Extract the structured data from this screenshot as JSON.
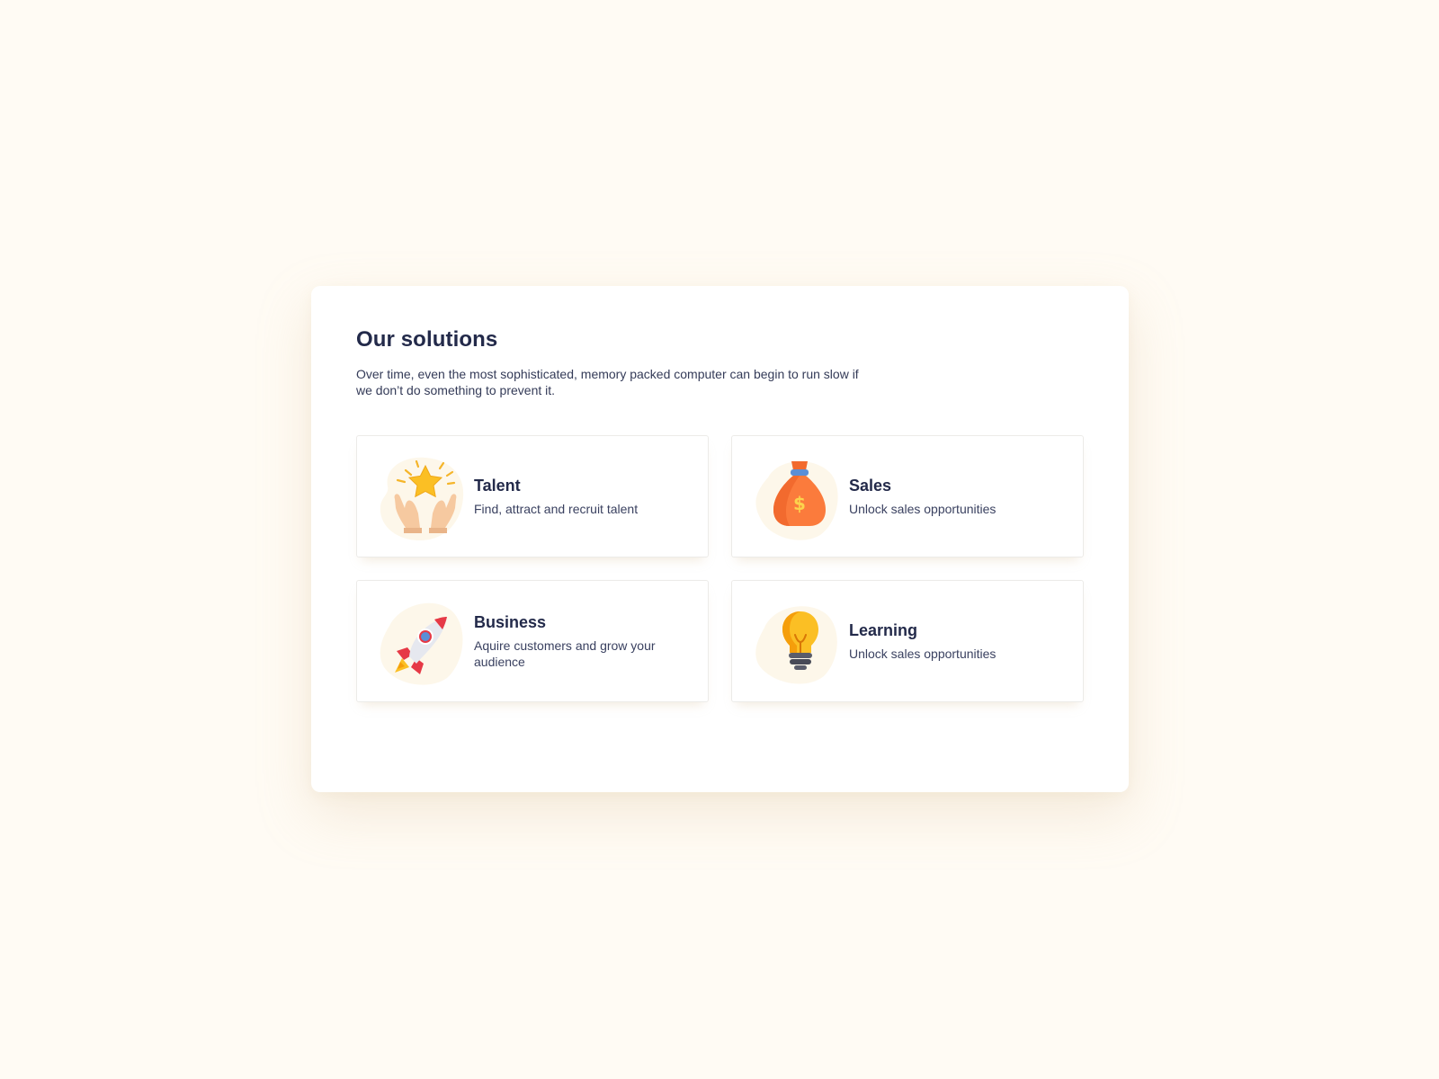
{
  "section": {
    "title": "Our solutions",
    "description": "Over time, even the most sophisticated, memory packed computer can begin to run slow if we don’t do something to prevent it."
  },
  "cards": [
    {
      "title": "Talent",
      "description": "Find, attract and recruit talent",
      "icon": "hands-star-icon"
    },
    {
      "title": "Sales",
      "description": "Unlock sales opportunities",
      "icon": "money-bag-icon"
    },
    {
      "title": "Business",
      "description": "Aquire customers and grow your audience",
      "icon": "rocket-icon"
    },
    {
      "title": "Learning",
      "description": "Unlock sales opportunities",
      "icon": "lightbulb-icon"
    }
  ],
  "colors": {
    "page_background": "#fffbf4",
    "heading_text": "#232a4a",
    "icon_blob": "#fdf7ea",
    "star": "#fbbf24",
    "money_bag": "#fb7b3c",
    "rocket": "#e63946",
    "bulb": "#fbbf24"
  }
}
